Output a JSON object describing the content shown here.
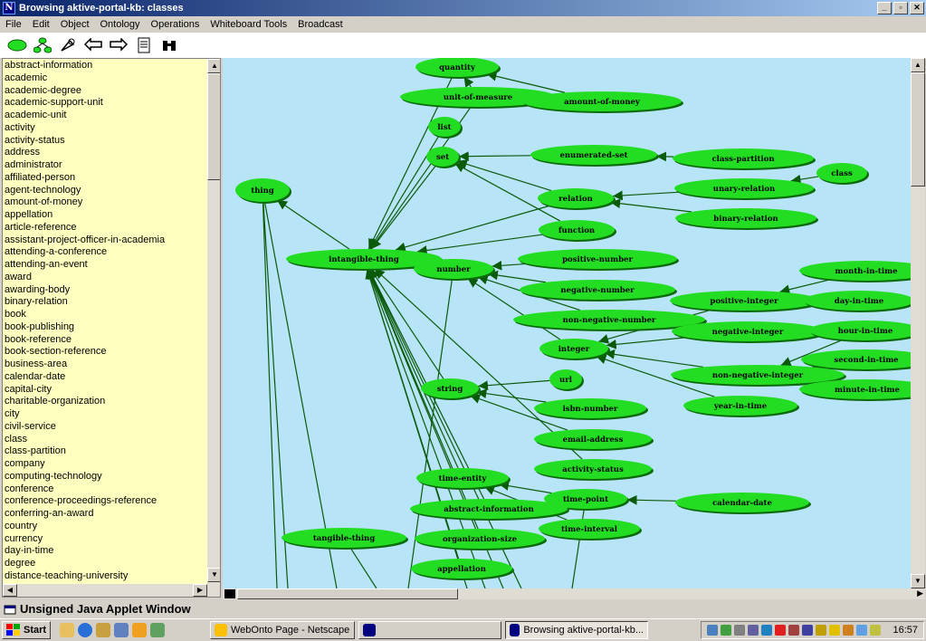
{
  "window": {
    "title": "Browsing aktive-portal-kb: classes",
    "logo": "N"
  },
  "menu": [
    "File",
    "Edit",
    "Object",
    "Ontology",
    "Operations",
    "Whiteboard Tools",
    "Broadcast"
  ],
  "toolbar_icons": [
    "ellipse-icon",
    "hierarchy-icon",
    "tools-icon",
    "back-arrow-icon",
    "forward-arrow-icon",
    "document-icon",
    "binoculars-icon"
  ],
  "classes": [
    "abstract-information",
    "academic",
    "academic-degree",
    "academic-support-unit",
    "academic-unit",
    "activity",
    "activity-status",
    "address",
    "administrator",
    "affiliated-person",
    "agent-technology",
    "amount-of-money",
    "appellation",
    "article-reference",
    "assistant-project-officer-in-academia",
    "attending-a-conference",
    "attending-an-event",
    "award",
    "awarding-body",
    "binary-relation",
    "book",
    "book-publishing",
    "book-reference",
    "book-section-reference",
    "business-area",
    "calendar-date",
    "capital-city",
    "charitable-organization",
    "city",
    "civil-service",
    "class",
    "class-partition",
    "company",
    "computing-technology",
    "conference",
    "conference-proceedings-reference",
    "conferring-an-award",
    "country",
    "currency",
    "day-in-time",
    "degree",
    "distance-teaching-university"
  ],
  "graph": {
    "colors": {
      "background": "#b8e4f8",
      "node": "#22dd22",
      "edge": "#0a5a0a"
    },
    "nodes": {
      "quantity": "quantity",
      "unit_of_measure": "unit-of-measure",
      "amount_of_money": "amount-of-money",
      "list": "list",
      "set": "set",
      "enumerated_set": "enumerated-set",
      "class_partition": "class-partition",
      "class": "class",
      "thing": "thing",
      "relation": "relation",
      "unary_relation": "unary-relation",
      "binary_relation": "binary-relation",
      "function": "function",
      "intangible_thing": "intangible-thing",
      "number": "number",
      "positive_number": "positive-number",
      "month_in_time": "month-in-time",
      "negative_number": "negative-number",
      "positive_integer": "positive-integer",
      "day_in_time": "day-in-time",
      "non_negative_number": "non-negative-number",
      "negative_integer": "negative-integer",
      "hour_in_time": "hour-in-time",
      "integer": "integer",
      "second_in_time": "second-in-time",
      "non_negative_integer": "non-negative-integer",
      "minute_in_time": "minute-in-time",
      "url": "url",
      "string": "string",
      "year_in_time": "year-in-time",
      "isbn_number": "isbn-number",
      "email_address": "email-address",
      "activity_status": "activity-status",
      "time_entity": "time-entity",
      "time_point": "time-point",
      "calendar_date": "calendar-date",
      "abstract_information": "abstract-information",
      "time_interval": "time-interval",
      "tangible_thing": "tangible-thing",
      "organization_size": "organization-size",
      "appellation": "appellation"
    }
  },
  "applet_status": "Unsigned Java Applet Window",
  "taskbar": {
    "start": "Start",
    "tasks": [
      "WebOnto Page - Netscape",
      "",
      "Browsing aktive-portal-kb..."
    ],
    "clock": "16:57"
  }
}
